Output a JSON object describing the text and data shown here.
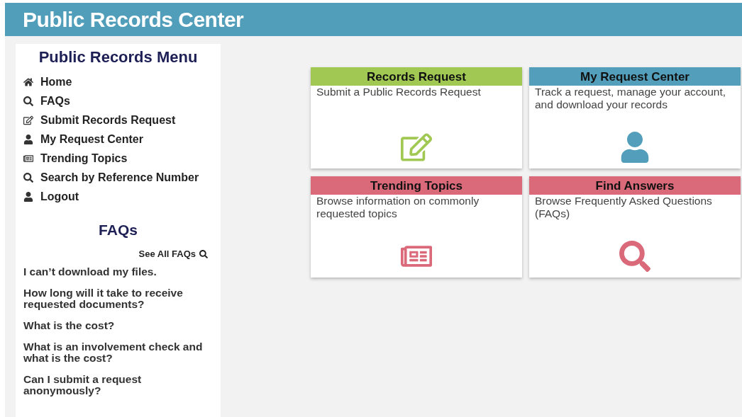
{
  "header": {
    "title": "Public Records Center"
  },
  "sidebar": {
    "title": "Public Records Menu",
    "items": [
      {
        "label": "Home",
        "kind": "home"
      },
      {
        "label": "FAQs",
        "kind": "search"
      },
      {
        "label": "Submit Records Request",
        "kind": "edit"
      },
      {
        "label": "My Request Center",
        "kind": "user"
      },
      {
        "label": "Trending Topics",
        "kind": "newspaper"
      },
      {
        "label": "Search by Reference Number",
        "kind": "search"
      },
      {
        "label": "Logout",
        "kind": "user"
      }
    ],
    "faqs": {
      "title": "FAQs",
      "see_all": "See All FAQs",
      "questions": [
        "I can’t download my files.",
        "How long will it take to receive requested documents?",
        "What is the cost?",
        "What is an involvement check and what is the cost?",
        "Can I submit a request anonymously?"
      ]
    }
  },
  "cards": [
    {
      "title": "Records Request",
      "description": "Submit a Public Records Request",
      "kind": "edit",
      "color": "#a0c853"
    },
    {
      "title": "My Request Center",
      "description": "Track a request, manage your account, and download your records",
      "kind": "user",
      "color": "#529ebb"
    },
    {
      "title": "Trending Topics",
      "description": "Browse information on commonly requested topics",
      "kind": "newspaper",
      "color": "#da6a7a"
    },
    {
      "title": "Find Answers",
      "description": "Browse Frequently Asked Questions (FAQs)",
      "kind": "search",
      "color": "#da6a7a"
    }
  ]
}
